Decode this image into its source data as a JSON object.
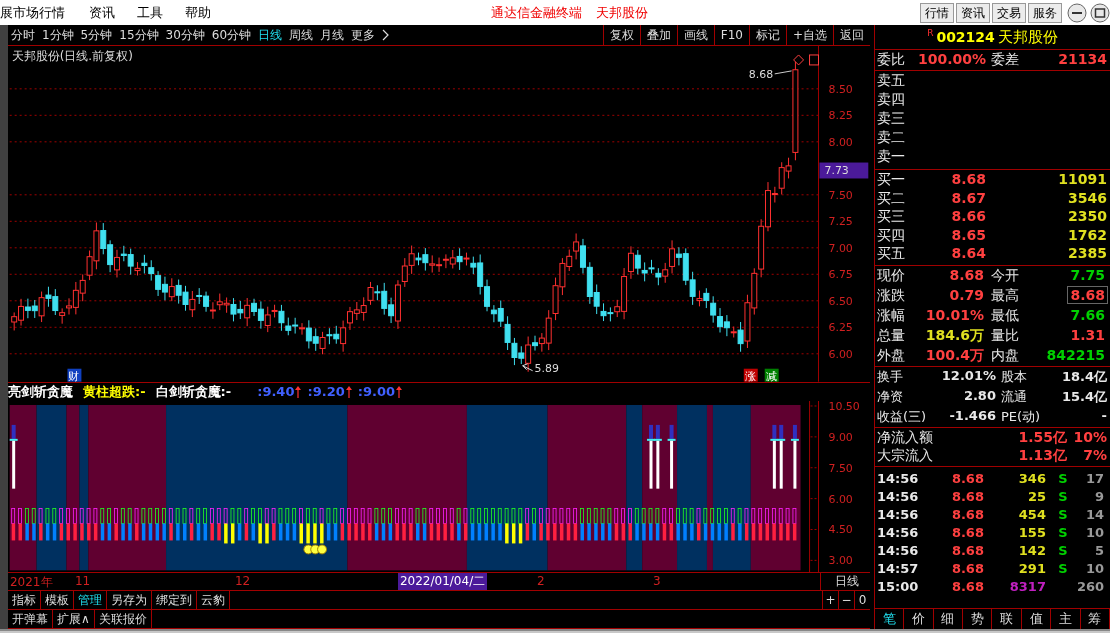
{
  "menu": {
    "app_fragment": "展市场行情",
    "items": [
      "资讯",
      "工具",
      "帮助"
    ],
    "title": "通达信金融终端",
    "stock_name": "天邦股份",
    "buttons": [
      "行情",
      "资讯",
      "交易",
      "服务"
    ]
  },
  "periods": [
    {
      "label": "分时",
      "selected": false
    },
    {
      "label": "1分钟",
      "selected": false
    },
    {
      "label": "5分钟",
      "selected": false
    },
    {
      "label": "15分钟",
      "selected": false
    },
    {
      "label": "30分钟",
      "selected": false
    },
    {
      "label": "60分钟",
      "selected": false
    },
    {
      "label": "日线",
      "selected": true
    },
    {
      "label": "周线",
      "selected": false
    },
    {
      "label": "月线",
      "selected": false
    },
    {
      "label": "更多",
      "selected": false
    }
  ],
  "tools": [
    "复权",
    "叠加",
    "画线",
    "F10",
    "标记",
    "+自选",
    "返回"
  ],
  "chart": {
    "title": "天邦股份(日线.前复权)",
    "yticks": [
      "8.50",
      "8.25",
      "8.00",
      "7.50",
      "7.25",
      "7.00",
      "6.75",
      "6.50",
      "6.25",
      "6.00"
    ],
    "current_price": "7.73",
    "high_label": "8.68",
    "low_label": "5.89",
    "badges": [
      {
        "text": "财",
        "color": "#1040c0"
      },
      {
        "text": "涨",
        "color": "#c00000"
      },
      {
        "text": "减",
        "color": "#008000"
      }
    ]
  },
  "indicator": {
    "legend": [
      {
        "text": "亮剑斩贪魔",
        "color": "#ffffff"
      },
      {
        "text": "黄柱超跌:-",
        "color": "#ffff00"
      },
      {
        "text": "白剑斩贪魔:-",
        "color": "#ffffff"
      }
    ],
    "levels": [
      ":9.40",
      ":9.20",
      ":9.00"
    ],
    "yticks": [
      "10.50",
      "9.00",
      "7.50",
      "6.00",
      "4.50",
      "3.00"
    ]
  },
  "time_axis": [
    {
      "label": "2021年",
      "highlighted": false
    },
    {
      "label": "11",
      "highlighted": false
    },
    {
      "label": "12",
      "highlighted": false
    },
    {
      "label": "2022/01/04/二",
      "highlighted": true
    },
    {
      "label": "2",
      "highlighted": false
    },
    {
      "label": "3",
      "highlighted": false
    }
  ],
  "period_label": "日线",
  "bottom_tabs": [
    {
      "label": "指标",
      "selected": false
    },
    {
      "label": "模板",
      "selected": false
    },
    {
      "label": "管理",
      "selected": true
    },
    {
      "label": "另存为",
      "selected": false
    },
    {
      "label": "绑定到",
      "selected": false
    },
    {
      "label": "云豹",
      "selected": false
    }
  ],
  "zoom_controls": [
    "+",
    "−",
    "0"
  ],
  "bottom_buttons": [
    "开弹幕",
    "扩展∧",
    "关联报价"
  ],
  "quote": {
    "flag": "R",
    "code": "002124",
    "name": "天邦股份",
    "ratio": [
      {
        "label": "委比",
        "value": "100.00%"
      },
      {
        "label": "委差",
        "value": "21134"
      }
    ],
    "asks": [
      "卖五",
      "卖四",
      "卖三",
      "卖二",
      "卖一"
    ],
    "bids": [
      {
        "label": "买一",
        "price": "8.68",
        "volume": "11091"
      },
      {
        "label": "买二",
        "price": "8.67",
        "volume": "3546"
      },
      {
        "label": "买三",
        "price": "8.66",
        "volume": "2350"
      },
      {
        "label": "买四",
        "price": "8.65",
        "volume": "1762"
      },
      {
        "label": "买五",
        "price": "8.64",
        "volume": "2385"
      }
    ],
    "stats": [
      {
        "label": "现价",
        "value": "8.68",
        "color": "#ff4040",
        "highlighted": false
      },
      {
        "label": "今开",
        "value": "7.75",
        "color": "#00d000",
        "highlighted": false
      },
      {
        "label": "涨跌",
        "value": "0.79",
        "color": "#ff4040",
        "highlighted": false
      },
      {
        "label": "最高",
        "value": "8.68",
        "color": "#ff4040",
        "highlighted": true
      },
      {
        "label": "涨幅",
        "value": "10.01%",
        "color": "#ff4040",
        "highlighted": false
      },
      {
        "label": "最低",
        "value": "7.66",
        "color": "#00d000",
        "highlighted": false
      },
      {
        "label": "总量",
        "value": "184.6万",
        "color": "#e0e020",
        "highlighted": false
      },
      {
        "label": "量比",
        "value": "1.31",
        "color": "#ff4040",
        "highlighted": false
      },
      {
        "label": "外盘",
        "value": "100.4万",
        "color": "#ff4040",
        "highlighted": false
      },
      {
        "label": "内盘",
        "value": "842215",
        "color": "#00d000",
        "highlighted": false
      }
    ],
    "fundamentals": [
      {
        "label": "换手",
        "value": "12.01%"
      },
      {
        "label": "股本",
        "value": "18.4亿"
      },
      {
        "label": "净资",
        "value": "2.80"
      },
      {
        "label": "流通",
        "value": "15.4亿"
      },
      {
        "label": "收益(三)",
        "value": "-1.466"
      },
      {
        "label": "PE(动)",
        "value": "-"
      }
    ],
    "flows": [
      {
        "label": "净流入额",
        "amount": "1.55亿",
        "percent": "10%"
      },
      {
        "label": "大宗流入",
        "amount": "1.13亿",
        "percent": "7%"
      }
    ],
    "trades": [
      {
        "time": "14:56",
        "price": "8.68",
        "volume": "346",
        "color": "#e0e020",
        "side": "S",
        "count": "17"
      },
      {
        "time": "14:56",
        "price": "8.68",
        "volume": "25",
        "color": "#e0e020",
        "side": "S",
        "count": "9"
      },
      {
        "time": "14:56",
        "price": "8.68",
        "volume": "454",
        "color": "#e0e020",
        "side": "S",
        "count": "14"
      },
      {
        "time": "14:56",
        "price": "8.68",
        "volume": "155",
        "color": "#e0e020",
        "side": "S",
        "count": "10"
      },
      {
        "time": "14:56",
        "price": "8.68",
        "volume": "142",
        "color": "#e0e020",
        "side": "S",
        "count": "5"
      },
      {
        "time": "14:57",
        "price": "8.68",
        "volume": "291",
        "color": "#e0e020",
        "side": "S",
        "count": "10"
      },
      {
        "time": "15:00",
        "price": "8.68",
        "volume": "8317",
        "color": "#c020c0",
        "count": "260"
      }
    ],
    "tabs": [
      {
        "label": "笔",
        "selected": true
      },
      {
        "label": "价",
        "selected": false
      },
      {
        "label": "细",
        "selected": false
      },
      {
        "label": "势",
        "selected": false
      },
      {
        "label": "联",
        "selected": false
      },
      {
        "label": "值",
        "selected": false
      },
      {
        "label": "主",
        "selected": false
      },
      {
        "label": "筹",
        "selected": false
      }
    ]
  }
}
